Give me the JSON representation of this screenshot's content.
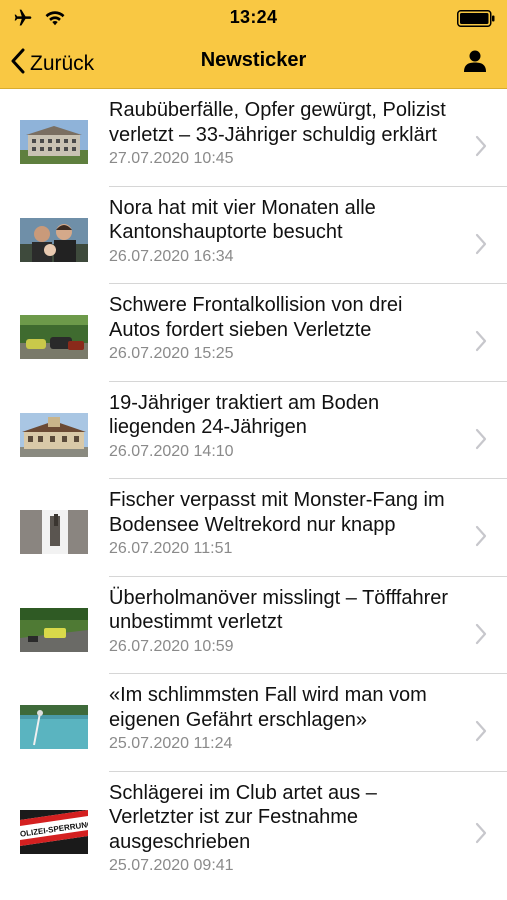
{
  "status_bar": {
    "time": "13:24",
    "icons": [
      "airplane-icon",
      "wifi-icon",
      "battery-icon"
    ]
  },
  "nav": {
    "back_label": "Zurück",
    "title": "Newsticker",
    "user_icon": "user-icon"
  },
  "colors": {
    "accent": "#f9c843",
    "date_text": "#8a8a8a",
    "chevron": "#c7c7cc"
  },
  "news": [
    {
      "title": "Raubüberfälle, Opfer gewürgt, Polizist verletzt – 33-Jähriger schuldig erklärt",
      "date": "27.07.2020 10:45"
    },
    {
      "title": "Nora hat mit vier Monaten alle Kantonshauptorte besucht",
      "date": "26.07.2020 16:34"
    },
    {
      "title": "Schwere Frontalkollision von drei Autos fordert sieben Verletzte",
      "date": "26.07.2020 15:25"
    },
    {
      "title": "19-Jähriger traktiert am Boden liegenden 24-Jährigen",
      "date": "26.07.2020 14:10"
    },
    {
      "title": "Fischer verpasst mit Monster-Fang im Bodensee Weltrekord nur knapp",
      "date": "26.07.2020 11:51"
    },
    {
      "title": "Überholmanöver misslingt – Töfffahrer unbestimmt verletzt",
      "date": "26.07.2020 10:59"
    },
    {
      "title": "«Im schlimmsten Fall wird man vom eigenen Gefährt erschlagen»",
      "date": "25.07.2020 11:24"
    },
    {
      "title": "Schlägerei im Club artet aus – Verletzter ist zur Festnahme ausgeschrieben",
      "date": "25.07.2020 09:41",
      "thumb_text": "POLIZEI-SPERRUNG"
    }
  ]
}
